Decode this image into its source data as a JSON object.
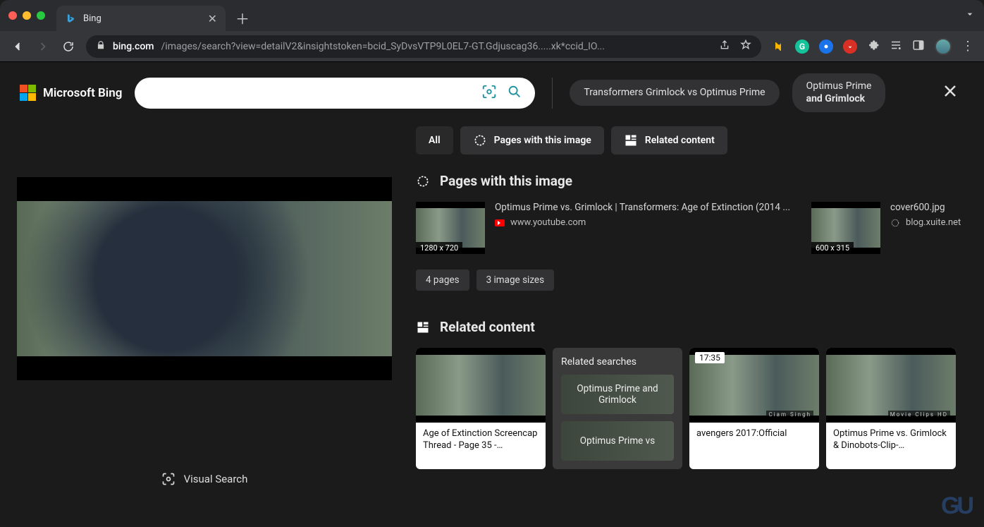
{
  "browser": {
    "tab_title": "Bing",
    "url_domain": "bing.com",
    "url_path": "/images/search?view=detailV2&insightstoken=bcid_SyDvsVTP9L0EL7-GT.Gdjuscag36.....xk*ccid_IO..."
  },
  "header": {
    "logo_text": "Microsoft Bing",
    "search_value": "",
    "pill1": "Transformers Grimlock vs Optimus Prime",
    "pill2_line1": "Optimus Prime",
    "pill2_line2": "and Grimlock"
  },
  "tabs": {
    "all": "All",
    "pages": "Pages with this image",
    "related": "Related content"
  },
  "pages_section": {
    "title": "Pages with this image",
    "items": [
      {
        "dims": "1280 x 720",
        "title": "Optimus Prime vs. Grimlock | Transformers: Age of Extinction (2014 ...",
        "source": "www.youtube.com",
        "source_kind": "youtube"
      },
      {
        "dims": "600 x 315",
        "title": "cover600.jpg",
        "source": "blog.xuite.net",
        "source_kind": "link"
      }
    ],
    "chips": [
      "4 pages",
      "3 image sizes"
    ]
  },
  "related_section": {
    "title": "Related content",
    "searches_label": "Related searches",
    "searches": [
      "Optimus Prime and Grimlock",
      "Optimus Prime vs"
    ],
    "cards": [
      {
        "caption": "Age of Extinction Screencap Thread - Page 35 -…"
      },
      {
        "caption": "avengers 2017:Official",
        "time": "17:35"
      },
      {
        "caption": "Optimus Prime vs. Grimlock & Dinobots-Clip-…"
      }
    ]
  },
  "left": {
    "visual_search": "Visual Search"
  }
}
